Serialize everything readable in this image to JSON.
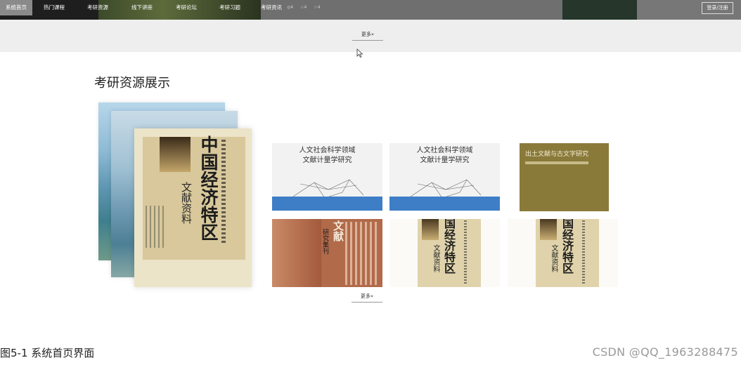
{
  "nav": {
    "items": [
      {
        "label": "系统首页",
        "active": true
      },
      {
        "label": "热门课程",
        "active": false
      },
      {
        "label": "考研资源",
        "active": false
      },
      {
        "label": "线下讲座",
        "active": false
      },
      {
        "label": "考研论坛",
        "active": false
      },
      {
        "label": "考研习题",
        "active": false
      },
      {
        "label": "考研资讯",
        "active": false
      }
    ],
    "login_label": "登录/注册"
  },
  "banner_stats": [
    "4",
    "4",
    "4"
  ],
  "more_top_label": "更多»",
  "section": {
    "title": "考研资源展示",
    "more_label": "更多»"
  },
  "featured_book": {
    "title": "中国经济特区",
    "subtitle": "文献资料"
  },
  "thumbs": [
    {
      "title_line1": "人文社会科学领域",
      "title_line2": "文献计量学研究"
    },
    {
      "title_line1": "人文社会科学领域",
      "title_line2": "文献计量学研究"
    },
    {
      "title": "出土文献与古文字研究"
    },
    {
      "title": "文献",
      "subtitle": "研究集刊"
    },
    {
      "title": "国经济特区",
      "subtitle": "文献资料"
    },
    {
      "title": "国经济特区",
      "subtitle": "文献资料"
    }
  ],
  "caption": "图5-1 系统首页界面",
  "watermark": "CSDN @QQ_1963288475",
  "colors": {
    "accent_band": "#3d7ec7",
    "nav_active": "#8a8a8a"
  }
}
